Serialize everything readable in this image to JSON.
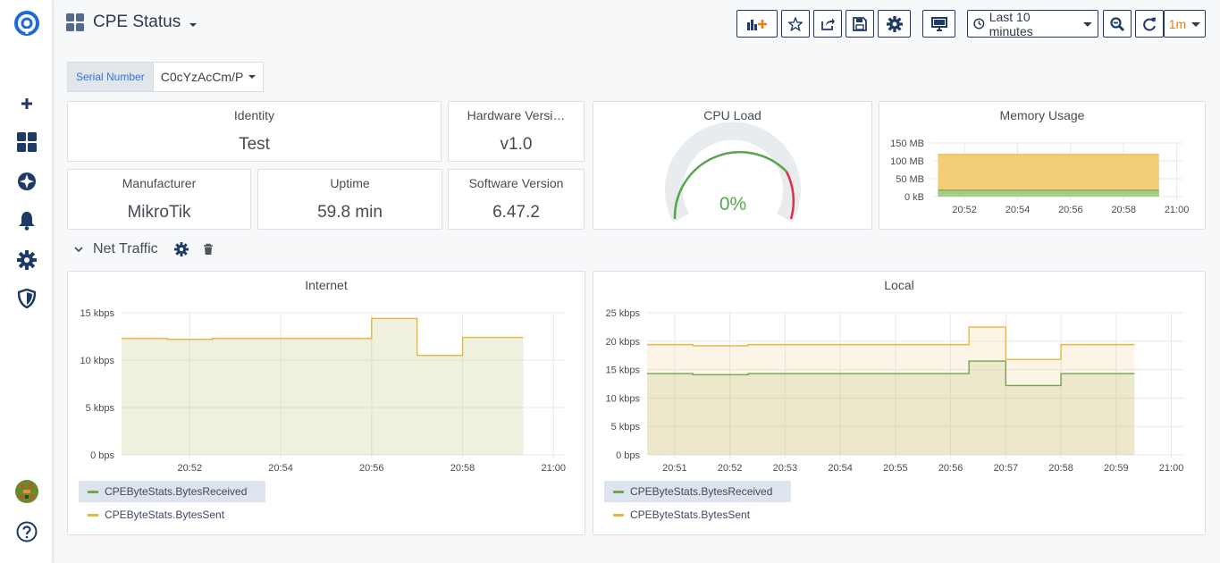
{
  "header": {
    "title": "CPE Status",
    "time_range": "Last 10 minutes",
    "refresh_interval": "1m"
  },
  "variables": {
    "serial_label": "Serial Number",
    "serial_value": "C0cYzAcCm/P"
  },
  "stats": {
    "identity": {
      "title": "Identity",
      "value": "Test"
    },
    "hardware": {
      "title": "Hardware Versi…",
      "value": "v1.0"
    },
    "manufacturer": {
      "title": "Manufacturer",
      "value": "MikroTik"
    },
    "uptime": {
      "title": "Uptime",
      "value": "59.8 min"
    },
    "software": {
      "title": "Software Version",
      "value": "6.47.2"
    }
  },
  "cpu": {
    "title": "CPU Load",
    "value_text": "0%",
    "value": 0,
    "ok_color": "#56a64b",
    "crit_color": "#e02f44"
  },
  "row": {
    "title": "Net Traffic"
  },
  "colors": {
    "received": "#73a54e",
    "sent": "#e8b73e",
    "accent": "#1e3a66"
  },
  "chart_data": [
    {
      "type": "area",
      "title": "Memory Usage",
      "x_ticks": [
        "20:52",
        "20:54",
        "20:56",
        "20:58",
        "21:00"
      ],
      "y_ticks": [
        "150 MB",
        "100 MB",
        "50 MB",
        "0 kB"
      ],
      "ylim": [
        0,
        150
      ],
      "series": [
        {
          "values": [
            18,
            18
          ],
          "x_range": [
            "20:51",
            "20:59:20"
          ]
        },
        {
          "values": [
            118,
            118
          ],
          "x_range": [
            "20:51",
            "20:59:20"
          ]
        }
      ]
    },
    {
      "type": "area",
      "title": "Internet",
      "x_ticks": [
        "20:52",
        "20:54",
        "20:56",
        "20:58",
        "21:00"
      ],
      "y_ticks": [
        "15 kbps",
        "10 kbps",
        "5 kbps",
        "0 bps"
      ],
      "ylim": [
        0,
        15
      ],
      "x": [
        "20:50:30",
        "20:51:30",
        "20:52:30",
        "20:53:30",
        "20:54:30",
        "20:55:30",
        "20:56:00",
        "20:57:00",
        "20:58:00",
        "20:59:20"
      ],
      "series": [
        {
          "name": "CPEByteStats.BytesSent",
          "values": [
            12.3,
            12.2,
            12.3,
            12.3,
            12.3,
            12.3,
            14.4,
            10.5,
            12.4,
            12.4
          ]
        }
      ],
      "legend": [
        "CPEByteStats.BytesReceived",
        "CPEByteStats.BytesSent"
      ]
    },
    {
      "type": "area",
      "title": "Local",
      "x_ticks": [
        "20:51",
        "20:52",
        "20:53",
        "20:54",
        "20:55",
        "20:56",
        "20:57",
        "20:58",
        "20:59",
        "21:00"
      ],
      "y_ticks": [
        "25 kbps",
        "20 kbps",
        "15 kbps",
        "10 kbps",
        "5 kbps",
        "0 bps"
      ],
      "ylim": [
        0,
        25
      ],
      "x": [
        "20:50:30",
        "20:51:20",
        "20:52:20",
        "20:54:00",
        "20:56:20",
        "20:57:00",
        "20:58:00",
        "20:59:20"
      ],
      "series": [
        {
          "name": "CPEByteStats.BytesReceived",
          "values": [
            14.3,
            14.1,
            14.3,
            14.3,
            16.5,
            12.2,
            14.3,
            14.3
          ]
        },
        {
          "name": "CPEByteStats.BytesSent",
          "values": [
            19.4,
            19.2,
            19.4,
            19.4,
            22.5,
            16.8,
            19.4,
            19.4
          ]
        }
      ],
      "legend": [
        "CPEByteStats.BytesReceived",
        "CPEByteStats.BytesSent"
      ]
    }
  ]
}
